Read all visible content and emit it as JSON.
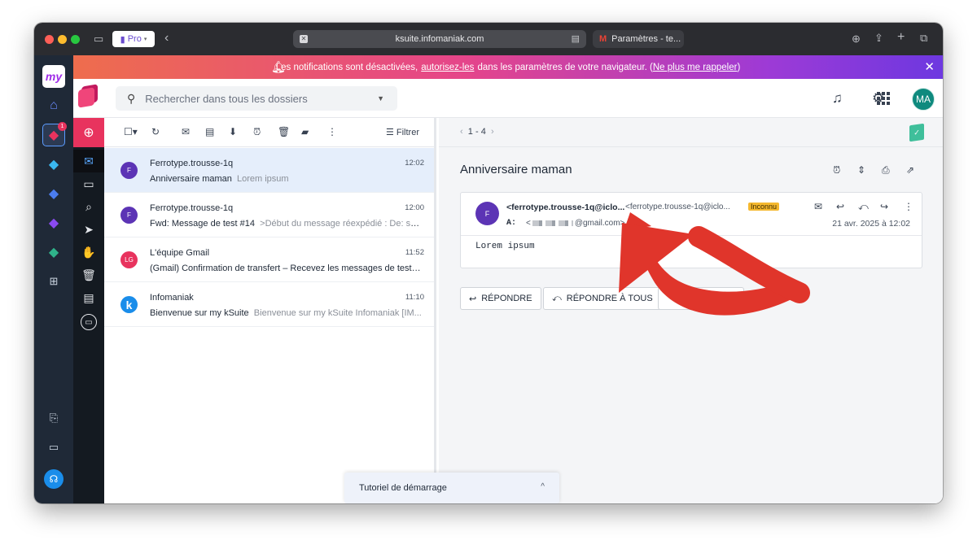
{
  "browser": {
    "pro_label": "Pro",
    "url": "ksuite.infomaniak.com",
    "tab_title": "Paramètres - te..."
  },
  "banner": {
    "prefix": "Les notifications sont désactivées,",
    "link1": "autorisez-les",
    "middle": "dans les paramètres de votre navigateur. (",
    "link2": "Ne plus me rappeler",
    "suffix": ")"
  },
  "header": {
    "search_placeholder": "Rechercher dans tous les dossiers",
    "avatar_initials": "MA"
  },
  "rail": {
    "logo_text": "my",
    "mail_badge": "1"
  },
  "toolbar": {
    "filter_label": "Filtrer"
  },
  "messages": [
    {
      "initial": "F",
      "color": "#5c34b5",
      "sender": "Ferrotype.trousse-1q",
      "time": "12:02",
      "subject": "Anniversaire maman",
      "preview": "Lorem ipsum"
    },
    {
      "initial": "F",
      "color": "#5c34b5",
      "sender": "Ferrotype.trousse-1q",
      "time": "12:00",
      "subject": "Fwd: Message de test #14",
      "preview": ">Début du message réexpédié : De: sen..."
    },
    {
      "initial": "LG",
      "color": "#e8335e",
      "sender": "L'équipe Gmail",
      "time": "11:52",
      "subject": "(Gmail) Confirmation de transfert – Recevez les messages de testm...",
      "preview": ""
    },
    {
      "initial": "k",
      "color": "#1a8dea",
      "sender": "Infomaniak",
      "time": "11:10",
      "subject": "Bienvenue sur my kSuite",
      "preview": "Bienvenue sur my kSuite Infomaniak [IM..."
    }
  ],
  "reader": {
    "pager": "1 - 4",
    "subject": "Anniversaire maman",
    "avatar_initial": "F",
    "from_name": "<ferrotype.trousse-1q@iclo...",
    "from_address": "<ferrotype.trousse-1q@iclo...",
    "unknown_tag": "Inconnu",
    "to_label": "A:",
    "to_open": "<",
    "to_domain": "@gmail.com>",
    "date": "21 avr. 2025 à 12:02",
    "body": "Lorem ipsum",
    "reply_label": "RÉPONDRE",
    "reply_all_label": "RÉPONDRE À TOUS"
  },
  "tutorial": {
    "label": "Tutoriel de démarrage"
  },
  "colors": {
    "accent": "#e8335e",
    "annotation_arrow": "#e0352b",
    "avatar_ma": "#0f8a7e"
  }
}
